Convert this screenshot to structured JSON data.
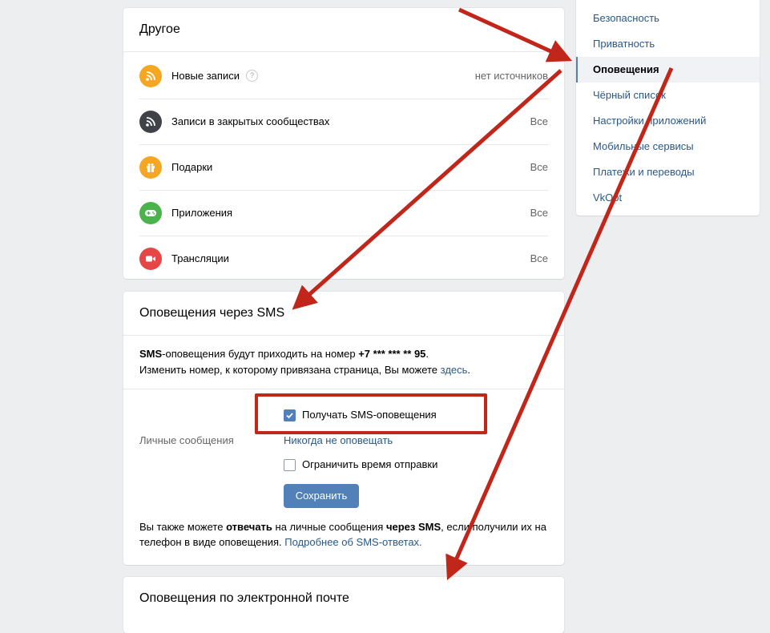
{
  "other": {
    "title": "Другое",
    "rows": [
      {
        "label": "Новые записи",
        "value": "нет источников",
        "icon": "rss-icon",
        "color": "#f5a623",
        "help": "?"
      },
      {
        "label": "Записи в закрытых сообществах",
        "value": "Все",
        "icon": "rss-icon",
        "color": "#3f4247"
      },
      {
        "label": "Подарки",
        "value": "Все",
        "icon": "gift-icon",
        "color": "#f5a623"
      },
      {
        "label": "Приложения",
        "value": "Все",
        "icon": "gamepad-icon",
        "color": "#4bb34b"
      },
      {
        "label": "Трансляции",
        "value": "Все",
        "icon": "camera-icon",
        "color": "#e64646"
      }
    ]
  },
  "sms": {
    "title": "Оповещения через SMS",
    "info_bold": "SMS",
    "info_text": "-оповещения будут приходить на номер ",
    "phone": "+7 *** *** ** 95",
    "info_end": ".",
    "change_text": "Изменить номер, к которому привязана страница, Вы можете ",
    "change_link": "здесь",
    "change_end": ".",
    "receive_label": "Получать SMS-оповещения",
    "receive_checked": true,
    "personal_label": "Личные сообщения",
    "personal_value": "Никогда не оповещать",
    "limit_label": "Ограничить время отправки",
    "limit_checked": false,
    "save_label": "Сохранить",
    "footer_1": "Вы также можете ",
    "footer_bold1": "отвечать",
    "footer_2": " на личные сообщения ",
    "footer_bold2": "через SMS",
    "footer_3": ", если получили их на телефон в виде оповещения. ",
    "footer_link": "Подробнее об SMS-ответах."
  },
  "email": {
    "title": "Оповещения по электронной почте"
  },
  "menu": {
    "items": [
      {
        "label": "Безопасность",
        "active": false
      },
      {
        "label": "Приватность",
        "active": false
      },
      {
        "label": "Оповещения",
        "active": true
      },
      {
        "label": "Чёрный список",
        "active": false
      },
      {
        "label": "Настройки приложений",
        "active": false
      },
      {
        "label": "Мобильные сервисы",
        "active": false
      },
      {
        "label": "Платежи и переводы",
        "active": false
      },
      {
        "label": "VkOpt",
        "active": false
      }
    ]
  },
  "colors": {
    "accent": "#5181b8",
    "link": "#2a5885",
    "annotation": "#c1261b"
  }
}
